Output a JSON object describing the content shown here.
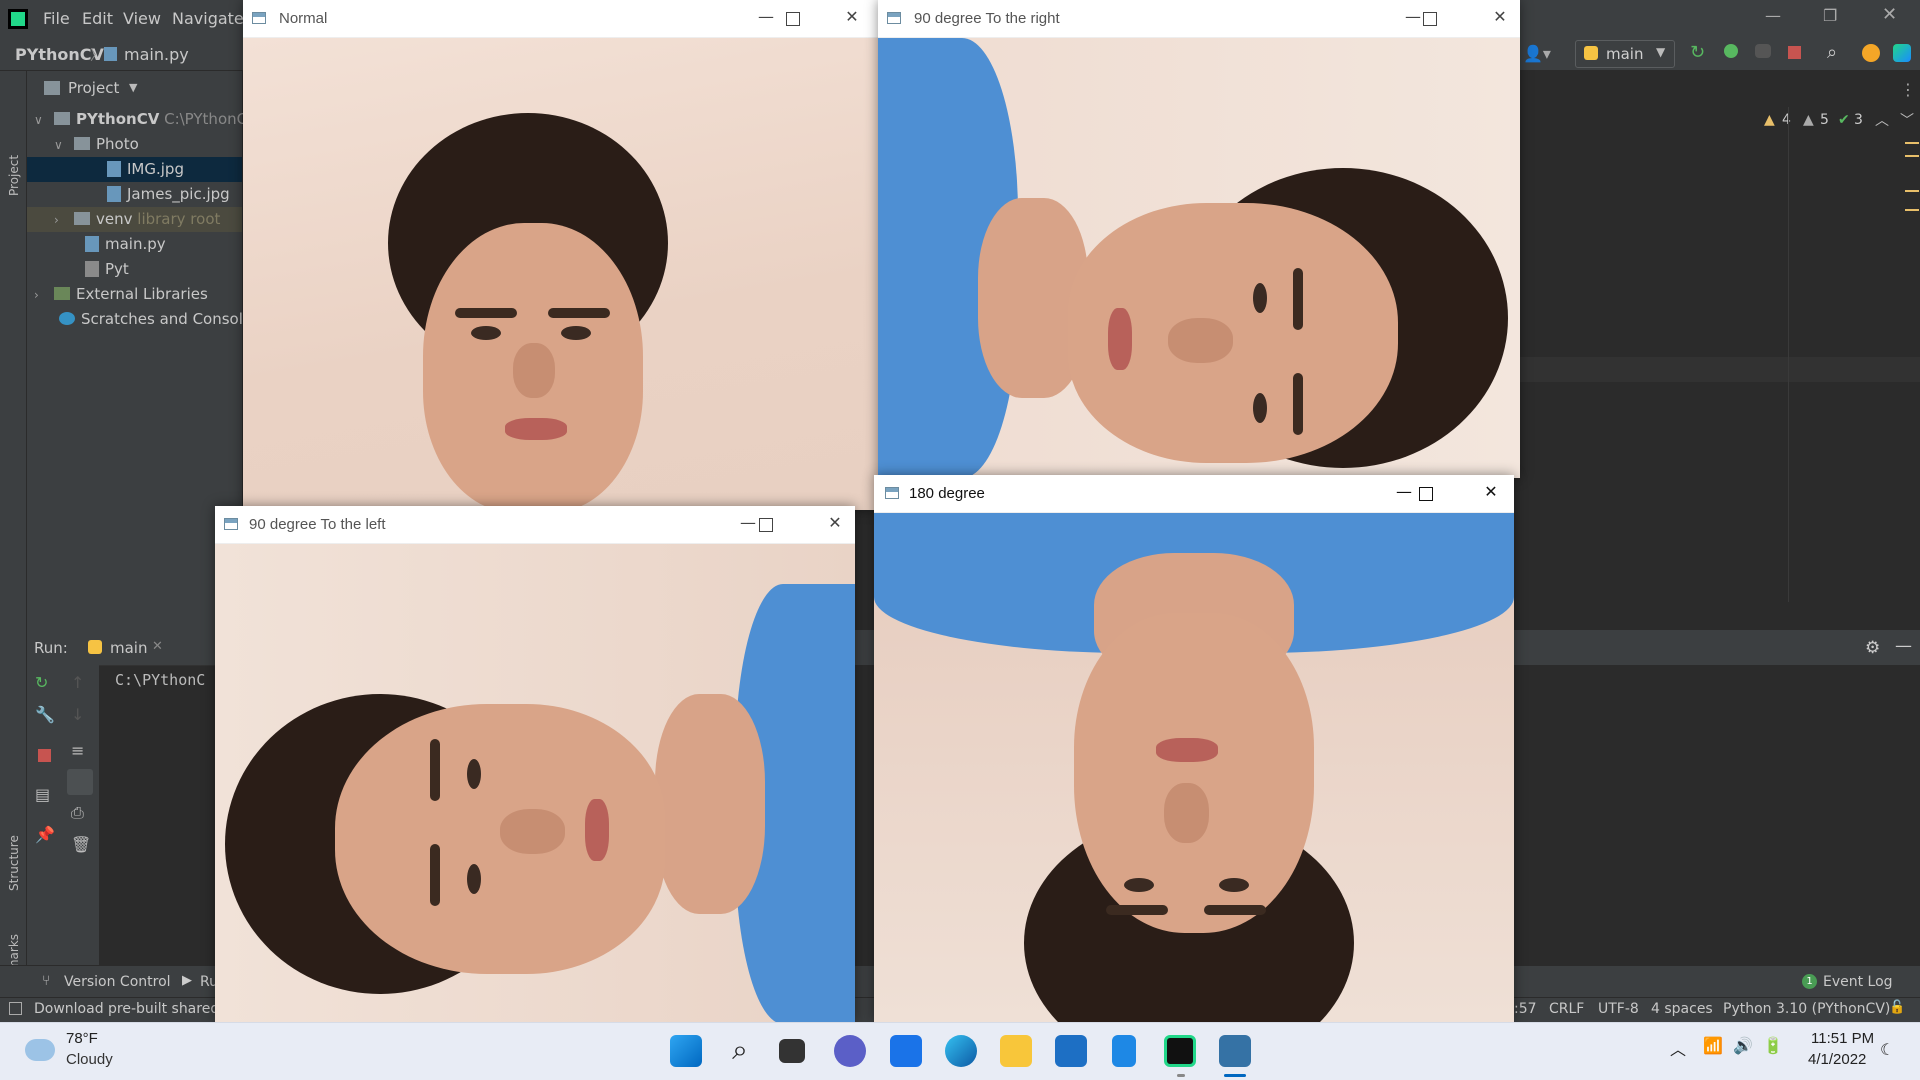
{
  "ide": {
    "menu": [
      "File",
      "Edit",
      "View",
      "Navigate"
    ],
    "breadcrumb": {
      "project": "PYthonCV",
      "file": "main.py"
    },
    "run_config": "main",
    "project_panel": {
      "header": "Project",
      "items": [
        {
          "label": "PYthonCV",
          "hint": "C:\\PYthonCV"
        },
        {
          "label": "Photo"
        },
        {
          "label": "IMG.jpg"
        },
        {
          "label": "James_pic.jpg"
        },
        {
          "label": "venv",
          "hint": "library root"
        },
        {
          "label": "main.py"
        },
        {
          "label": "Pyt"
        },
        {
          "label": "External Libraries"
        },
        {
          "label": "Scratches and Consoles"
        }
      ]
    },
    "inspections": {
      "warn_a": "4",
      "warn_b": "5",
      "ok": "3"
    },
    "run_panel": {
      "label": "Run:",
      "tab": "main",
      "console": "C:\\PYthonC"
    },
    "left_strip": {
      "project": "Project",
      "structure": "Structure",
      "bookmarks": "Bookmarks"
    },
    "bottom_tabs": {
      "version_control": "Version Control",
      "run": "Ru",
      "event_log": "Event Log",
      "event_count": "1"
    },
    "status": {
      "message": "Download pre-built shared",
      "pos": ":57",
      "line_sep": "CRLF",
      "encoding": "UTF-8",
      "indent": "4 spaces",
      "interpreter": "Python 3.10 (PYthonCV)"
    }
  },
  "windows": {
    "normal": {
      "title": "Normal"
    },
    "right": {
      "title": "90 degree To the right"
    },
    "left": {
      "title": "90 degree To the left"
    },
    "flip": {
      "title": "180 degree"
    }
  },
  "taskbar": {
    "weather_temp": "78°F",
    "weather_desc": "Cloudy",
    "time": "11:51 PM",
    "date": "4/1/2022"
  },
  "colors": {
    "ide_bg": "#3c3f41",
    "shirt": "#4e8fd3",
    "selection": "#0d293e"
  }
}
